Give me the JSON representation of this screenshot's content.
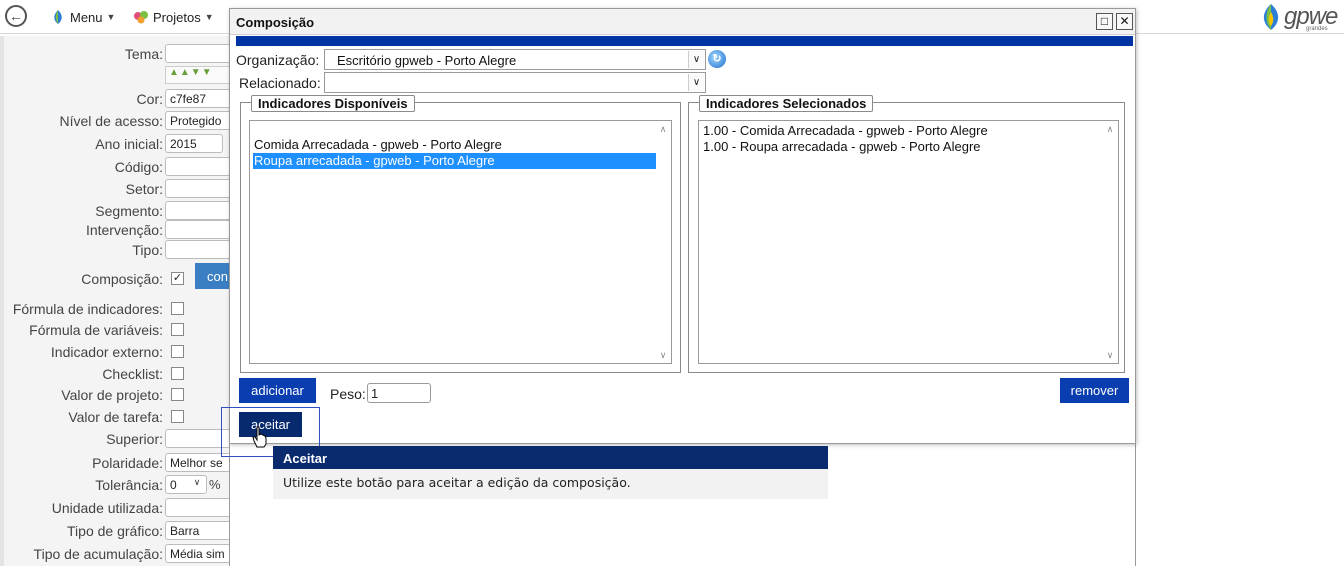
{
  "topbar": {
    "menu_label": "Menu",
    "projetos_label": "Projetos",
    "logo_text": "gpwe",
    "logo_sub": "grandes"
  },
  "form": {
    "rows": [
      {
        "label": "Tema:",
        "value": ""
      },
      {
        "label": "Cor:",
        "value": "c7fe87"
      },
      {
        "label": "Nível de acesso:",
        "value": "Protegido"
      },
      {
        "label": "Ano inicial:",
        "value": "2015"
      },
      {
        "label": "Código:",
        "value": ""
      },
      {
        "label": "Setor:",
        "value": ""
      },
      {
        "label": "Segmento:",
        "value": ""
      },
      {
        "label": "Intervenção:",
        "value": ""
      },
      {
        "label": "Tipo:",
        "value": ""
      },
      {
        "label": "Composição:",
        "value": "✓",
        "button": "con"
      },
      {
        "label": "Fórmula de indicadores:"
      },
      {
        "label": "Fórmula de variáveis:"
      },
      {
        "label": "Indicador externo:"
      },
      {
        "label": "Checklist:"
      },
      {
        "label": "Valor de projeto:"
      },
      {
        "label": "Valor de tarefa:"
      },
      {
        "label": "Superior:",
        "value": ""
      },
      {
        "label": "Polaridade:",
        "value": "Melhor se"
      },
      {
        "label": "Tolerância:",
        "value": "0",
        "unit": "%"
      },
      {
        "label": "Unidade utilizada:",
        "value": ""
      },
      {
        "label": "Tipo de gráfico:",
        "value": "Barra"
      },
      {
        "label": "Tipo de acumulação:",
        "value": "Média sim"
      }
    ]
  },
  "dialog": {
    "title": "Composição",
    "organizacao_label": "Organização:",
    "organizacao_value": "Escritório gpweb - Porto Alegre",
    "relacionado_label": "Relacionado:",
    "relacionado_value": "",
    "disponiveis_legend": "Indicadores Disponíveis",
    "disponiveis_items": [
      "Comida Arrecadada - gpweb - Porto Alegre",
      "Roupa arrecadada - gpweb - Porto Alegre"
    ],
    "selecionados_legend": "Indicadores Selecionados",
    "selecionados_items": [
      "1.00 - Comida Arrecadada - gpweb - Porto Alegre",
      "1.00 - Roupa arrecadada - gpweb - Porto Alegre"
    ],
    "adicionar_label": "adicionar",
    "peso_label": "Peso:",
    "peso_value": "1",
    "remover_label": "remover",
    "aceitar_label": "aceitar"
  },
  "tooltip": {
    "title": "Aceitar",
    "body": "Utilize este botão para aceitar a edição da composição."
  },
  "colors": {
    "dialog_band": "#0033a3",
    "button_blue": "#0a3eb0",
    "tooltip_head": "#0a2a6e",
    "selection": "#1e90ff"
  }
}
